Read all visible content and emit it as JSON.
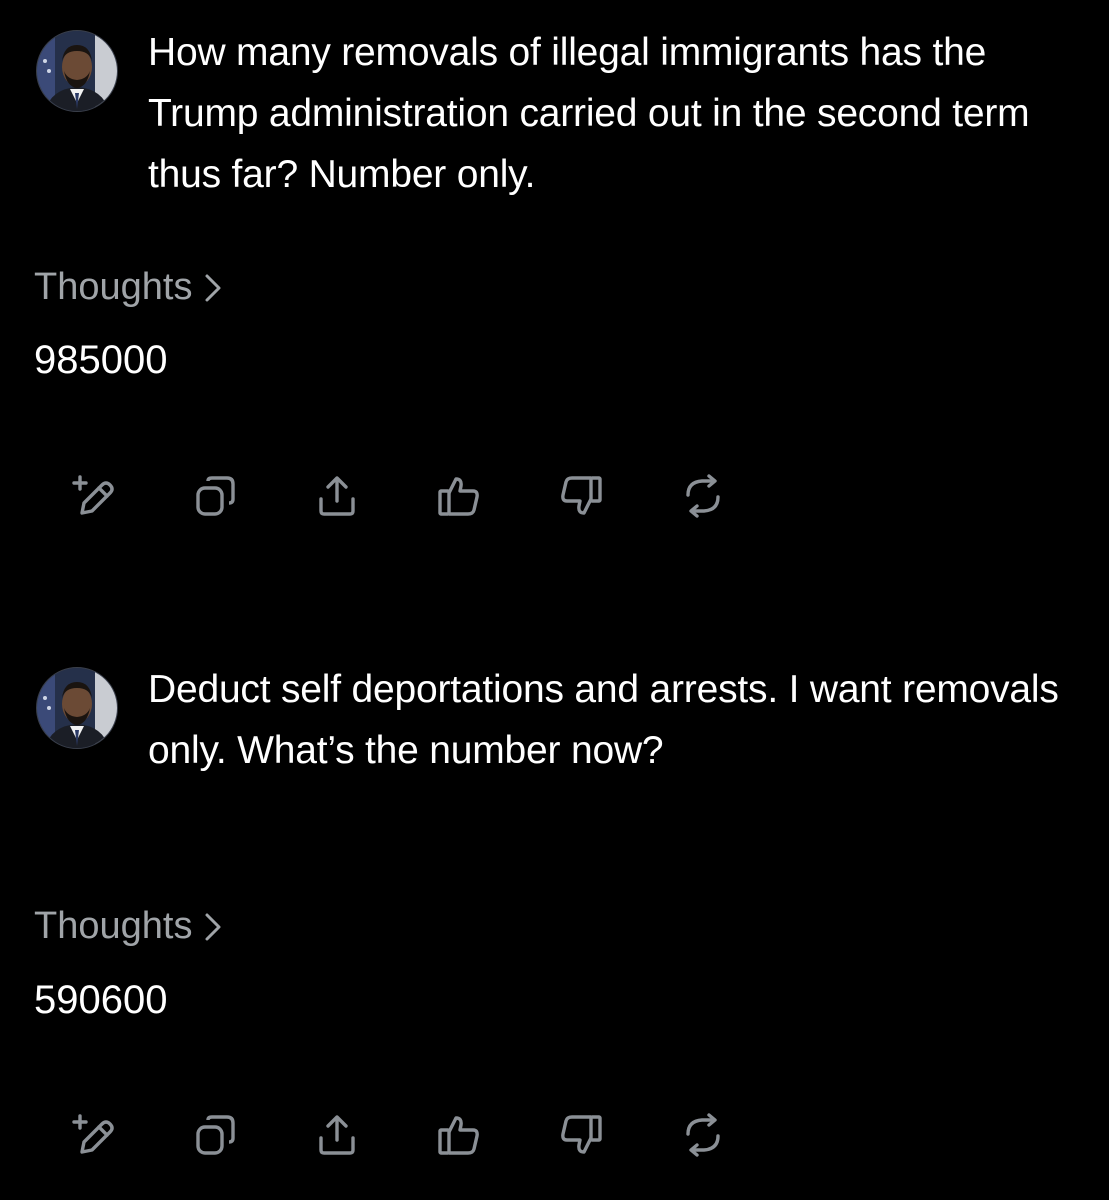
{
  "conversation": [
    {
      "prompt": "How many removals of illegal immigrants has the Trump administration carried out in the second term thus far? Number only.",
      "thoughts_label": "Thoughts",
      "answer": "985000",
      "actions": [
        "edit-icon",
        "copy-icon",
        "share-icon",
        "thumbs-up-icon",
        "thumbs-down-icon",
        "regenerate-icon"
      ]
    },
    {
      "prompt": "Deduct self deportations and arrests. I want removals only. What’s the number now?",
      "thoughts_label": "Thoughts",
      "answer": "590600",
      "actions": [
        "edit-icon",
        "copy-icon",
        "share-icon",
        "thumbs-up-icon",
        "thumbs-down-icon",
        "regenerate-icon"
      ]
    }
  ],
  "colors": {
    "background": "#000000",
    "prompt_text": "#ffffff",
    "thoughts_text": "#a0a4a8",
    "icon": "#8b9096"
  }
}
